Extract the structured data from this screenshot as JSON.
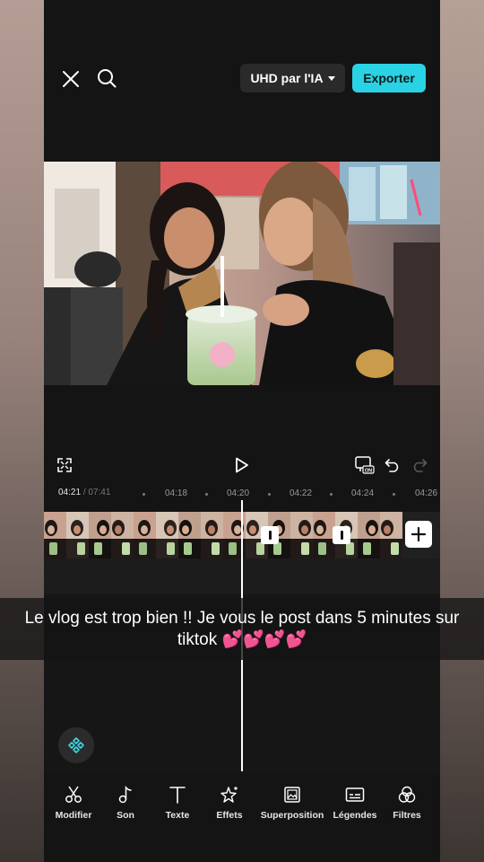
{
  "header": {
    "quality_label": "UHD par l'IA",
    "export_label": "Exporter"
  },
  "icons": {
    "close": "close-icon",
    "search": "search-icon",
    "fullscreen": "fullscreen-icon",
    "play": "play-icon",
    "captions_toggle": "captions-on-icon",
    "undo": "undo-icon",
    "redo": "redo-icon",
    "add": "plus-icon",
    "keyframe": "keyframe-icon"
  },
  "ruler": {
    "current": "04:21",
    "separator": "/",
    "total": "07:41",
    "ticks": [
      "04:18",
      "04:20",
      "04:22",
      "04:24",
      "04:26"
    ]
  },
  "toolbar": {
    "items": [
      {
        "label": "Modifier",
        "icon": "scissors-icon"
      },
      {
        "label": "Son",
        "icon": "music-note-icon"
      },
      {
        "label": "Texte",
        "icon": "text-icon"
      },
      {
        "label": "Effets",
        "icon": "sparkle-star-icon"
      },
      {
        "label": "Superposition",
        "icon": "overlay-icon"
      },
      {
        "label": "Légendes",
        "icon": "captions-icon"
      },
      {
        "label": "Filtres",
        "icon": "filters-icon"
      }
    ]
  },
  "caption": {
    "text": "Le vlog est trop bien !! Je vous le post dans 5 minutes sur tiktok 💕💕💕💕"
  },
  "colors": {
    "accent": "#2ad3e4",
    "background": "#141414"
  }
}
